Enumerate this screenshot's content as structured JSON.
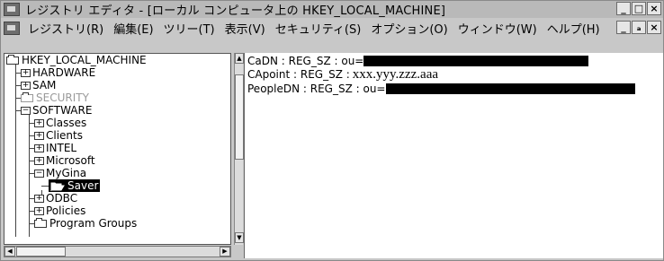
{
  "window": {
    "title": "レジストリ エディタ - [ローカル コンピュータ上の HKEY_LOCAL_MACHINE]",
    "buttons": [
      "_",
      "□",
      "×"
    ]
  },
  "menubar": {
    "items": [
      "レジストリ(R)",
      "編集(E)",
      "ツリー(T)",
      "表示(V)",
      "セキュリティ(S)",
      "オプション(O)",
      "ウィンドウ(W)",
      "ヘルプ(H)"
    ],
    "child_buttons": [
      "_",
      "ₐ",
      "×"
    ]
  },
  "tree": {
    "root": "HKEY_LOCAL_MACHINE",
    "items": [
      {
        "label": "HARDWARE",
        "box": "+"
      },
      {
        "label": "SAM",
        "box": "+"
      },
      {
        "label": "SECURITY",
        "box": ""
      },
      {
        "label": "SOFTWARE",
        "box": "−"
      },
      {
        "label": "Classes",
        "box": "+"
      },
      {
        "label": "Clients",
        "box": "+"
      },
      {
        "label": "INTEL",
        "box": "+"
      },
      {
        "label": "Microsoft",
        "box": "+"
      },
      {
        "label": "MyGina",
        "box": "−"
      },
      {
        "label": "Saver",
        "box": ""
      },
      {
        "label": "ODBC",
        "box": "+"
      },
      {
        "label": "Policies",
        "box": "+"
      },
      {
        "label": "Program Groups",
        "box": ""
      }
    ]
  },
  "values": [
    {
      "name": "CaDN : REG_SZ : ou=",
      "data": ""
    },
    {
      "name": "CApoint : REG_SZ :",
      "data": "xxx.yyy.zzz.aaa"
    },
    {
      "name": "PeopleDN : REG_SZ : ou=",
      "data": ""
    }
  ],
  "scroll_arrows": {
    "up": "▲",
    "down": "▼",
    "left": "◀",
    "right": "▶"
  }
}
